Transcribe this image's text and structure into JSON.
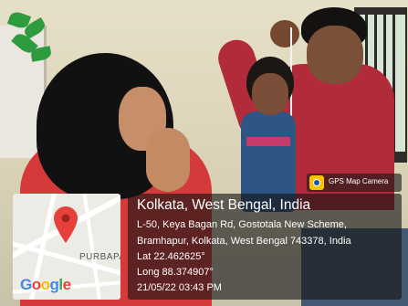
{
  "badge": {
    "icon": "gps-camera-icon",
    "label": "GPS Map Camera"
  },
  "map": {
    "icon": "map-pin-icon",
    "area_label": "PURBAPA",
    "brand": [
      "G",
      "o",
      "o",
      "g",
      "l",
      "e"
    ],
    "pin_color": "#e5413a"
  },
  "location": {
    "city": "Kolkata, West Bengal, India",
    "address_line1": "L-50, Keya Bagan Rd, Gostotala New Scheme,",
    "address_line2": "Bramhapur, Kolkata, West Bengal 743378, India",
    "lat": "Lat 22.462625°",
    "long": "Long 88.374907°",
    "datetime": "21/05/22 03:43 PM"
  }
}
